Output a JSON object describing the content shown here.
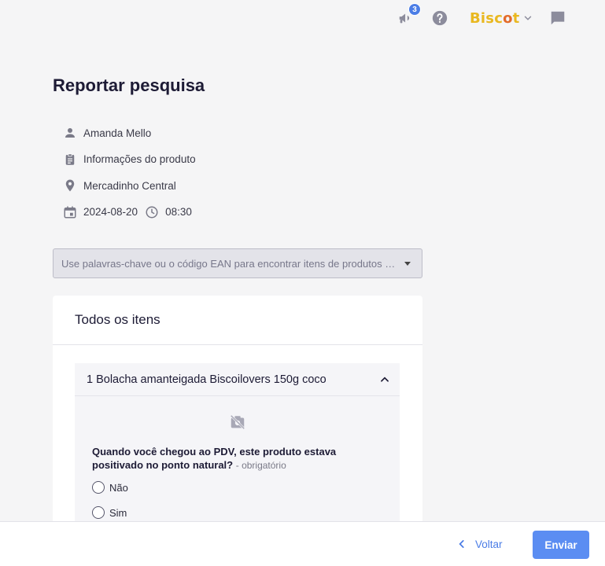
{
  "topbar": {
    "notifications_count": "3",
    "brand_name_prefix": "Bisc",
    "brand_name_suffix": "t",
    "brand_o": "o"
  },
  "page": {
    "title": "Reportar pesquisa"
  },
  "meta": {
    "user": "Amanda Mello",
    "section": "Informações do produto",
    "store": "Mercadinho Central",
    "date": "2024-08-20",
    "time": "08:30"
  },
  "search": {
    "placeholder": "Use palavras-chave ou o código EAN para encontrar itens de produtos e..."
  },
  "card": {
    "title": "Todos os itens",
    "item": {
      "title": "1 Bolacha amanteigada Biscoilovers 150g coco",
      "question": "Quando você chegou ao PDV, este produto estava positivado no ponto natural?",
      "required_label": "- obrigatório",
      "options": [
        "Não",
        "Sim"
      ]
    }
  },
  "footer": {
    "back_label": "Voltar",
    "send_label": "Enviar"
  },
  "colors": {
    "accent": "#4b7de6",
    "brand": "#e9b820"
  }
}
